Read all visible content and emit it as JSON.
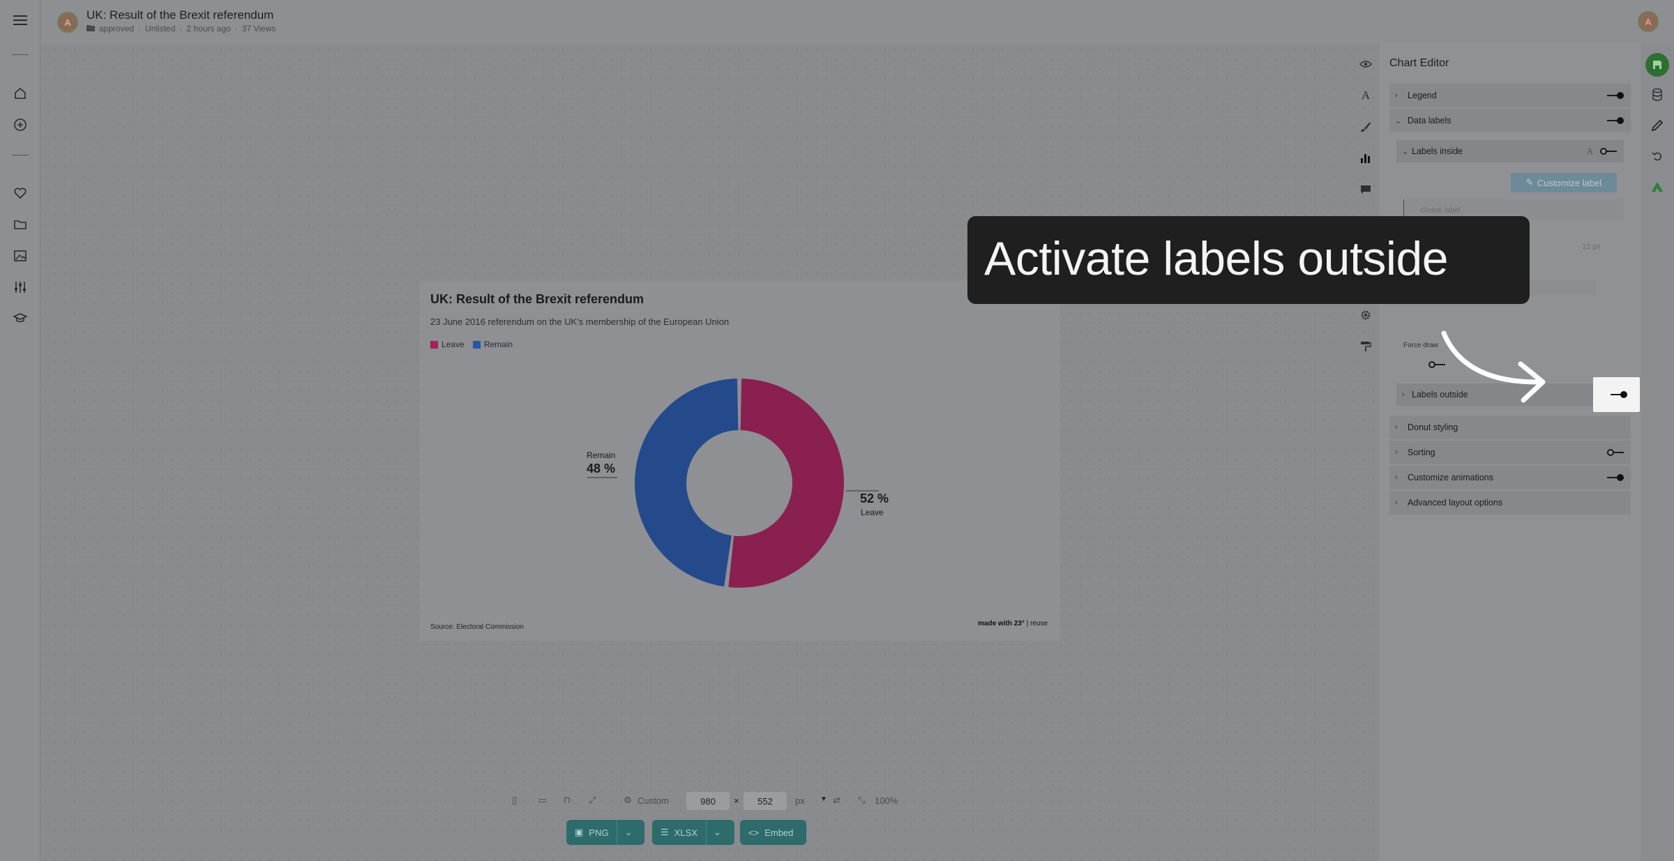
{
  "header": {
    "logo_initial": "A",
    "title": "UK: Result of the Brexit referendum",
    "meta": {
      "status": "approved",
      "visibility": "Unlisted",
      "updated": "2 hours ago",
      "views": "37 Views"
    },
    "user_initial": "A"
  },
  "nav": {
    "icons": [
      "menu-icon",
      "home-icon",
      "add-icon",
      "heart-icon",
      "folder-icon",
      "image-icon",
      "sliders-icon",
      "graduation-cap-icon"
    ]
  },
  "chart": {
    "title": "UK: Result of the Brexit referendum",
    "subtitle": "23 June 2016 referendum on the UK's membership of the European Union",
    "source": "Source: Electoral Commission",
    "credit_main": "made with 23°",
    "credit_sep": " | ",
    "credit_link": "reuse",
    "legend": [
      {
        "name": "Leave",
        "color": "#a3225c"
      },
      {
        "name": "Remain",
        "color": "#2b55a3"
      }
    ]
  },
  "chart_data": {
    "type": "pie",
    "title": "UK: Result of the Brexit referendum",
    "subtitle": "23 June 2016 referendum on the UK's membership of the European Union",
    "categories": [
      "Leave",
      "Remain"
    ],
    "values": [
      52,
      48
    ],
    "value_labels": [
      "52 %",
      "48 %"
    ],
    "colors": [
      "#8a2050",
      "#244a8c"
    ],
    "donut": true,
    "legend": "top-left",
    "source": "Source: Electoral Commission"
  },
  "tools": [
    "eye-icon",
    "text-icon",
    "brush-icon",
    "bar-chart-icon",
    "comment-icon",
    "table-icon",
    "gear-icon",
    "paint-roller-icon"
  ],
  "editor": {
    "title": "Chart Editor",
    "sections": {
      "legend": "Legend",
      "data_labels": "Data labels",
      "labels_inside": "Labels inside",
      "customize_label": "Customize label",
      "global_label": "Global label",
      "font_size": "12 px",
      "force_draw": "Force draw",
      "labels_outside": "Labels outside",
      "donut_styling": "Donut styling",
      "sorting": "Sorting",
      "customize_animations": "Customize animations",
      "advanced_layout": "Advanced layout options"
    }
  },
  "bottom": {
    "preset": "Custom",
    "width": "980",
    "times": "×",
    "height": "552",
    "unit": "px",
    "zoom": "100%",
    "export_png": "PNG",
    "export_xlsx": "XLSX",
    "embed": "Embed"
  },
  "overlay": {
    "instruction": "Activate labels outside"
  }
}
